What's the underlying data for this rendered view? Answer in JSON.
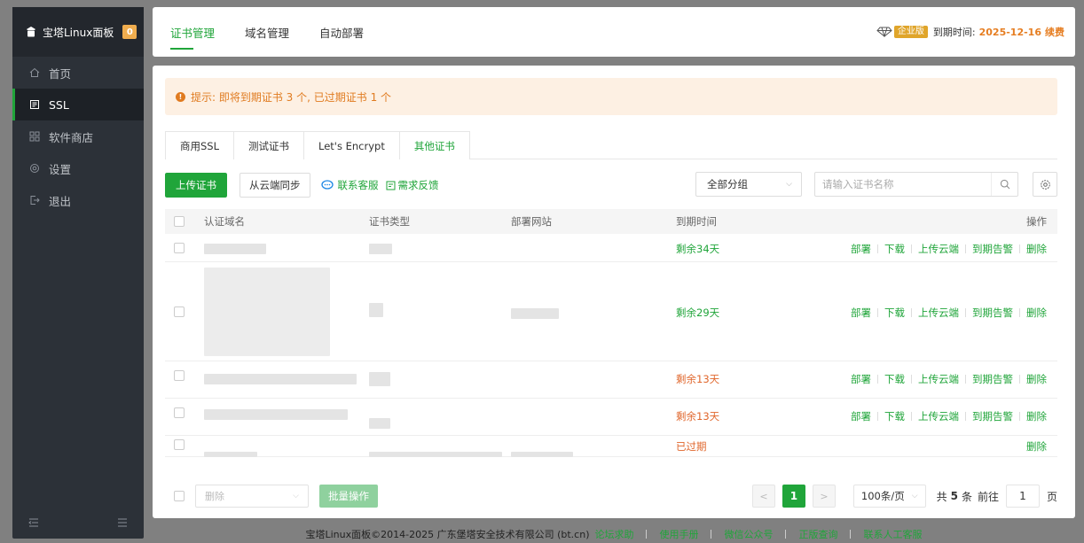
{
  "app": {
    "title": "宝塔Linux面板",
    "badge": "0"
  },
  "sidebar": {
    "items": [
      {
        "label": "首页",
        "icon": "home-icon"
      },
      {
        "label": "SSL",
        "icon": "ssl-icon"
      },
      {
        "label": "软件商店",
        "icon": "grid-icon"
      },
      {
        "label": "设置",
        "icon": "gear-icon"
      },
      {
        "label": "退出",
        "icon": "logout-icon"
      }
    ]
  },
  "top_tabs": [
    "证书管理",
    "域名管理",
    "自动部署"
  ],
  "top_right": {
    "edition": "企业版",
    "expire_label": "到期时间:",
    "expire_date": "2025-12-16",
    "renew": "续费"
  },
  "notice": {
    "text": "提示: 即将到期证书 3 个, 已过期证书 1 个"
  },
  "cert_tabs": [
    "商用SSL",
    "测试证书",
    "Let's Encrypt",
    "其他证书"
  ],
  "toolbar": {
    "upload": "上传证书",
    "sync": "从云端同步",
    "contact": "联系客服",
    "feedback": "需求反馈",
    "group": "全部分组",
    "search_placeholder": "请输入证书名称"
  },
  "table": {
    "headers": {
      "domain": "认证域名",
      "type": "证书类型",
      "site": "部署网站",
      "expire": "到期时间",
      "ops": "操作"
    },
    "rows": [
      {
        "expire": "剩余34天"
      },
      {
        "expire": "剩余29天"
      },
      {
        "expire": "剩余13天"
      },
      {
        "expire": "剩余13天"
      },
      {
        "expire": "已过期"
      }
    ],
    "ops": {
      "deploy": "部署",
      "download": "下载",
      "upload_cloud": "上传云端",
      "alert": "到期告警",
      "delete": "删除"
    }
  },
  "batch": {
    "select": "删除",
    "button": "批量操作"
  },
  "pager": {
    "current": "1",
    "per_page": "100条/页",
    "total_prefix": "共",
    "total": "5",
    "total_suffix": "条",
    "goto_label": "前往",
    "goto_value": "1",
    "page_unit": "页"
  },
  "footer": {
    "copyright": "宝塔Linux面板©2014-2025 广东堡塔安全技术有限公司 (bt.cn)",
    "links": [
      "论坛求助",
      "使用手册",
      "微信公众号",
      "正版查询",
      "联系人工客服"
    ]
  },
  "colors": {
    "accent": "#20a53a",
    "warning": "#e07b20",
    "sidebar": "#2c3138"
  }
}
